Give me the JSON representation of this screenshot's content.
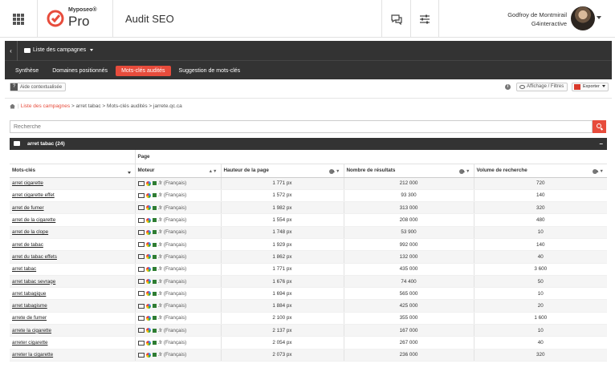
{
  "header": {
    "logo_small": "Myposeo®",
    "logo_large": "Pro",
    "page_title": "Audit SEO",
    "user_name": "Godfroy de Montmirail",
    "user_company": "G4interactive"
  },
  "nav": {
    "campaigns_label": "Liste des campagnes",
    "tabs": [
      {
        "label": "Synthèse",
        "active": false
      },
      {
        "label": "Domaines positionnés",
        "active": false
      },
      {
        "label": "Mots-clés audités",
        "active": true
      },
      {
        "label": "Suggestion de mots-clés",
        "active": false
      }
    ]
  },
  "toolbar": {
    "help_label": "Aide contextualisée",
    "filter_label": "Affichage / Filtres",
    "export_label": "Exporter"
  },
  "breadcrumb": {
    "link": "Liste des campagnes",
    "rest": " > arret tabac > Mots-clés audités > jarrete.qc.ca"
  },
  "search": {
    "placeholder": "Recherche"
  },
  "group": {
    "title": "arret tabac (24)"
  },
  "table": {
    "group_header": "Page",
    "columns": [
      "Mots-clés",
      "Moteur",
      "Hauteur de la page",
      "Nombre de résultats",
      "Volume de recherche"
    ],
    "rows": [
      {
        "kw": "arret cigarette",
        "engine": ".fr (Français)",
        "height": "1 771 px",
        "results": "212 000",
        "volume": "720"
      },
      {
        "kw": "arret cigarette effet",
        "engine": ".fr (Français)",
        "height": "1 572 px",
        "results": "93 300",
        "volume": "140"
      },
      {
        "kw": "arret de fumer",
        "engine": ".fr (Français)",
        "height": "1 982 px",
        "results": "313 000",
        "volume": "320"
      },
      {
        "kw": "arret de la cigarette",
        "engine": ".fr (Français)",
        "height": "1 554 px",
        "results": "208 000",
        "volume": "480"
      },
      {
        "kw": "arret de la clope",
        "engine": ".fr (Français)",
        "height": "1 748 px",
        "results": "53 900",
        "volume": "10"
      },
      {
        "kw": "arret de tabac",
        "engine": ".fr (Français)",
        "height": "1 929 px",
        "results": "992 000",
        "volume": "140"
      },
      {
        "kw": "arret du tabac effets",
        "engine": ".fr (Français)",
        "height": "1 862 px",
        "results": "132 000",
        "volume": "40"
      },
      {
        "kw": "arret tabac",
        "engine": ".fr (Français)",
        "height": "1 771 px",
        "results": "435 000",
        "volume": "3 600"
      },
      {
        "kw": "arret tabac sevrage",
        "engine": ".fr (Français)",
        "height": "1 676 px",
        "results": "74 400",
        "volume": "50"
      },
      {
        "kw": "arret tabagique",
        "engine": ".fr (Français)",
        "height": "1 694 px",
        "results": "565 000",
        "volume": "10"
      },
      {
        "kw": "arret tabagisme",
        "engine": ".fr (Français)",
        "height": "1 884 px",
        "results": "425 000",
        "volume": "20"
      },
      {
        "kw": "arrete de fumer",
        "engine": ".fr (Français)",
        "height": "2 100 px",
        "results": "355 000",
        "volume": "1 600"
      },
      {
        "kw": "arrete la cigarette",
        "engine": ".fr (Français)",
        "height": "2 137 px",
        "results": "167 000",
        "volume": "10"
      },
      {
        "kw": "arreter cigarette",
        "engine": ".fr (Français)",
        "height": "2 054 px",
        "results": "267 000",
        "volume": "40"
      },
      {
        "kw": "arreter la cigarette",
        "engine": ".fr (Français)",
        "height": "2 073 px",
        "results": "236 000",
        "volume": "320"
      }
    ]
  },
  "colors": {
    "accent": "#e74c3c",
    "dark": "#333333"
  }
}
